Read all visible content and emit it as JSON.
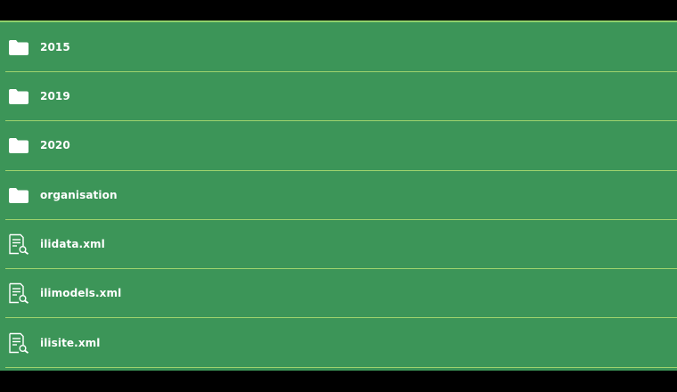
{
  "list": {
    "items": [
      {
        "type": "folder",
        "icon": "folder-icon",
        "label": "2015"
      },
      {
        "type": "folder",
        "icon": "folder-icon",
        "label": "2019"
      },
      {
        "type": "folder",
        "icon": "folder-icon",
        "label": "2020"
      },
      {
        "type": "folder",
        "icon": "folder-icon",
        "label": "organisation"
      },
      {
        "type": "file",
        "icon": "document-search-icon",
        "label": "ilidata.xml"
      },
      {
        "type": "file",
        "icon": "document-search-icon",
        "label": "ilimodels.xml"
      },
      {
        "type": "file",
        "icon": "document-search-icon",
        "label": "ilisite.xml"
      }
    ]
  },
  "colors": {
    "background": "#3c9558",
    "divider": "#9fd36e",
    "text": "#ffffff",
    "frame": "#000000"
  }
}
